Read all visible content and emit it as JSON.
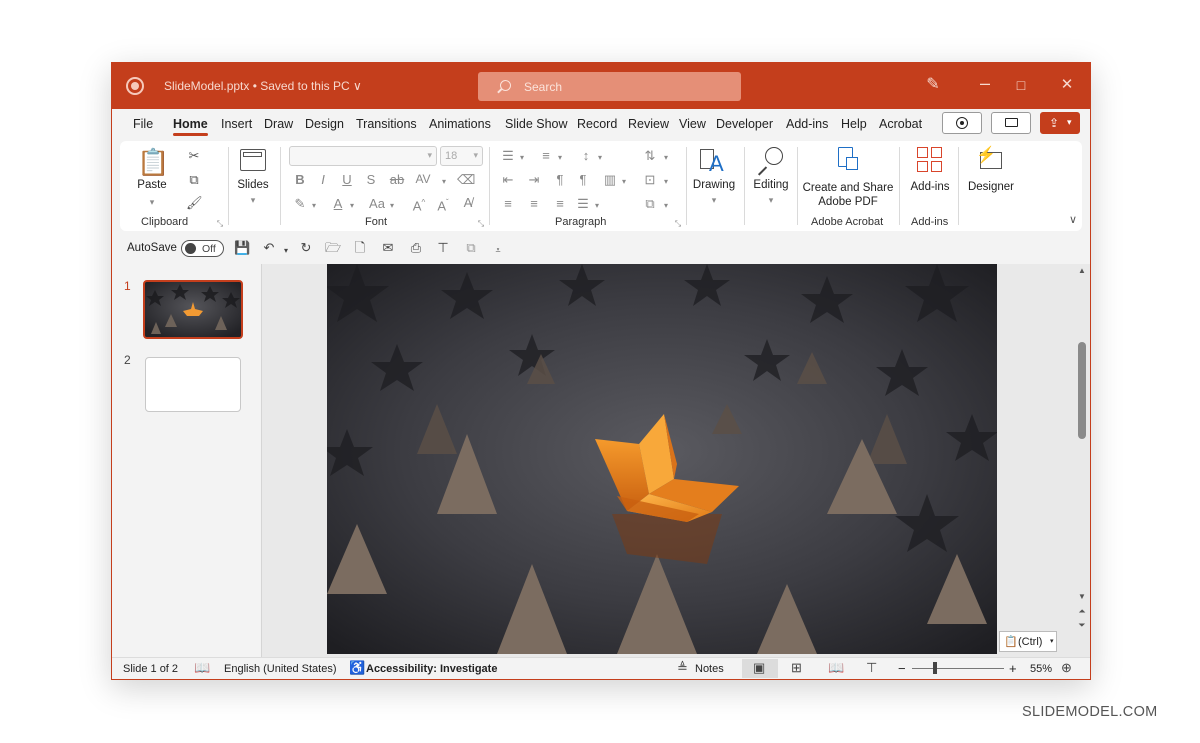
{
  "colors": {
    "accent": "#c43e1c",
    "search_bg": "#e58f77",
    "window_bg": "#f3f3f3"
  },
  "titlebar": {
    "doc_title": "SlideModel.pptx • Saved to this PC ∨",
    "search_placeholder": "Search",
    "icons": [
      "designer-pen-icon",
      "minimize-icon",
      "maximize-icon",
      "close-icon"
    ]
  },
  "tabs": [
    "File",
    "Home",
    "Insert",
    "Draw",
    "Design",
    "Transitions",
    "Animations",
    "Slide Show",
    "Record",
    "Review",
    "View",
    "Developer",
    "Add-ins",
    "Help",
    "Acrobat"
  ],
  "ribbon": {
    "clipboard": {
      "paste": "Paste",
      "label": "Clipboard"
    },
    "slides": {
      "label": "Slides"
    },
    "font": {
      "size": "18",
      "label": "Font"
    },
    "paragraph": {
      "label": "Paragraph"
    },
    "drawing": {
      "label": "Drawing"
    },
    "editing": {
      "label": "Editing"
    },
    "acrobat": {
      "button_line1": "Create and Share",
      "button_line2": "Adobe PDF",
      "label": "Adobe Acrobat"
    },
    "addins": {
      "button": "Add-ins",
      "label": "Add-ins"
    },
    "designer": {
      "button": "Designer"
    }
  },
  "qat": {
    "autosave": "AutoSave",
    "toggle": "Off"
  },
  "slides_pane": {
    "numbers": [
      "1",
      "2"
    ]
  },
  "paste_options": "(Ctrl)",
  "statusbar": {
    "slide_count": "Slide 1 of 2",
    "language": "English (United States)",
    "accessibility": "Accessibility: Investigate",
    "notes": "Notes",
    "zoom_minus": "−",
    "zoom_plus": "+",
    "zoom": "55%"
  },
  "watermark": "SLIDEMODEL.COM"
}
